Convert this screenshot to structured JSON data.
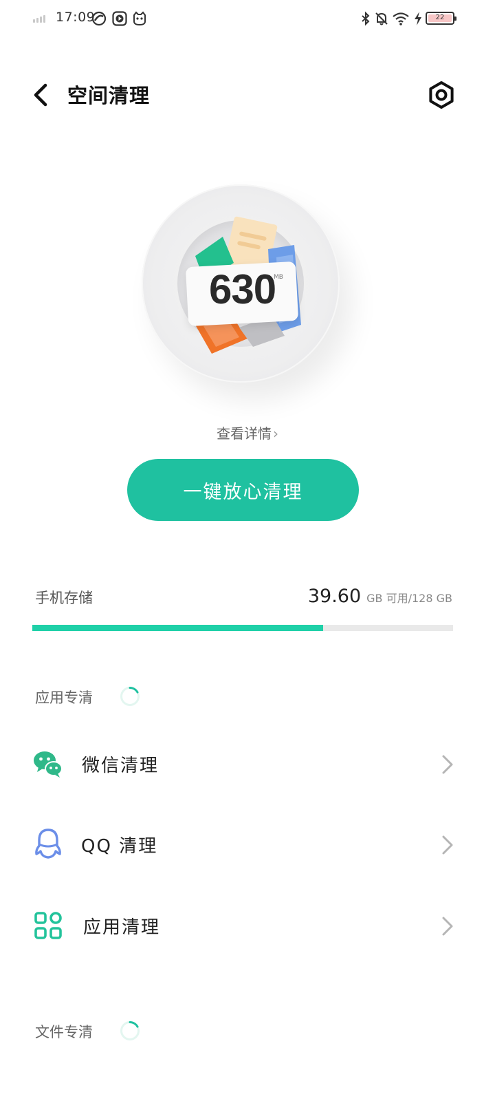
{
  "status_bar": {
    "time": "17:09",
    "battery_level": "22",
    "icons": [
      "cellular-signal-icon",
      "sync-icon",
      "play-icon",
      "cat-icon",
      "bluetooth-icon",
      "bell-off-icon",
      "wifi-icon",
      "charging-icon",
      "battery-icon"
    ]
  },
  "header": {
    "title": "空间清理",
    "back_icon": "chevron-left-icon",
    "settings_icon": "settings-icon"
  },
  "hero": {
    "amount": "630",
    "unit": "MB"
  },
  "details_link": {
    "label": "查看详情",
    "chevron": "›"
  },
  "clean_button": {
    "label": "一键放心清理"
  },
  "storage": {
    "label": "手机存储",
    "available": "39.60",
    "available_unit": "GB 可用",
    "total": "/128 GB",
    "used_fraction": 0.691
  },
  "app_section": {
    "label": "应用专清",
    "items": [
      {
        "label": "微信清理",
        "icon": "wechat-icon"
      },
      {
        "label": "QQ 清理",
        "icon": "qq-icon"
      },
      {
        "label": "应用清理",
        "icon": "apps-grid-icon"
      }
    ]
  },
  "file_section": {
    "label": "文件专清"
  },
  "colors": {
    "accent": "#1fc1a0",
    "progress": "#1fd0a8",
    "wechat": "#2fb889",
    "qq": "#6b8ee8",
    "apps": "#23c39b"
  }
}
